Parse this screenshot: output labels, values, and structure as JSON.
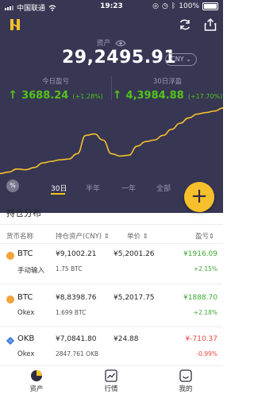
{
  "status_bar": {
    "carrier": "中国联通",
    "time": "19:23",
    "battery": "100%"
  },
  "header": {
    "asset_label": "资产",
    "total": "29,2495.91",
    "currency": "CNY",
    "today_label": "今日盈亏",
    "today_value": "3688.24",
    "today_pct": "(+1.28%)",
    "month_label": "30日浮盈",
    "month_value": "4,3984.88",
    "month_pct": "(+17.70%)"
  },
  "ranges": {
    "badge": "%",
    "items": [
      "30日",
      "半年",
      "一年",
      "全部"
    ],
    "active": "30日"
  },
  "fab_label": "+",
  "holdings": {
    "title": "持仓分布",
    "columns": {
      "coin": "货币名称",
      "holding": "持仓资产(CNY)",
      "price": "单价",
      "pnl": "盈亏"
    },
    "rows": [
      {
        "coin": "BTC",
        "source": "手动输入",
        "holding": "¥9,1002.21",
        "amount": "1.75 BTC",
        "price": "¥5,2001.26",
        "pnl": "¥1916.09",
        "pnl_pct": "+2.15%",
        "trend": "up"
      },
      {
        "coin": "BTC",
        "source": "Okex",
        "holding": "¥8,8398.76",
        "amount": "1.699 BTC",
        "price": "¥5,2017.75",
        "pnl": "¥1888.70",
        "pnl_pct": "+2.18%",
        "trend": "up"
      },
      {
        "coin": "OKB",
        "source": "Okex",
        "holding": "¥7,0841.80",
        "amount": "2847.761 OKB",
        "price": "¥24.88",
        "pnl": "¥-710.37",
        "pnl_pct": "-0.99%",
        "trend": "down"
      }
    ]
  },
  "tabbar": {
    "items": [
      "资产",
      "行情",
      "我的"
    ]
  },
  "colors": {
    "header_bg": "#373653",
    "accent": "#f6c02c",
    "positive": "#3aa832",
    "negative": "#e8483b"
  },
  "chart_data": {
    "type": "line",
    "series": [
      {
        "values": [
          12,
          14,
          18,
          17,
          20,
          26,
          28,
          30,
          31,
          38,
          62,
          64,
          56,
          38,
          35,
          36,
          48,
          54,
          56,
          62,
          70,
          78,
          85,
          90,
          92,
          94,
          98
        ]
      }
    ],
    "ylim": [
      0,
      100
    ]
  }
}
